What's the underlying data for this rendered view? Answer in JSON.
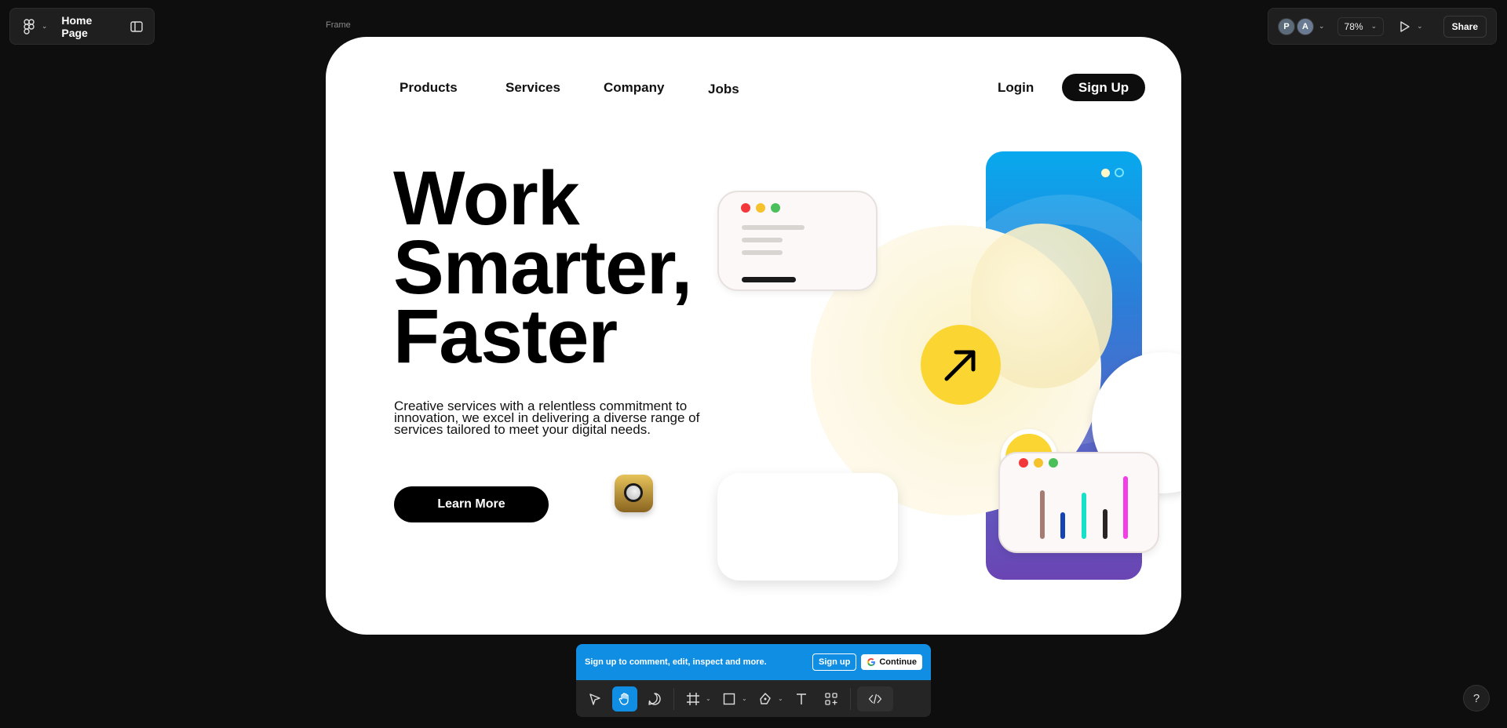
{
  "file": {
    "title": "Home Page"
  },
  "frame_label": "Frame",
  "topbar": {
    "avatars": [
      "P",
      "A"
    ],
    "zoom": "78%",
    "share_label": "Share"
  },
  "site": {
    "nav": [
      "Products",
      "Services",
      "Company",
      "Jobs"
    ],
    "login": "Login",
    "signup": "Sign Up",
    "hero_title_lines": [
      "Work",
      "Smarter,",
      "Faster"
    ],
    "hero_subtitle": "Creative services with a relentless commitment to innovation, we excel in delivering a diverse range of services tailored to meet your digital needs.",
    "cta": "Learn More",
    "chart_bar_colors": [
      "#a67b74",
      "#1443b4",
      "#17e0c9",
      "#2b2424",
      "#f53ce8"
    ]
  },
  "banner": {
    "text": "Sign up to comment, edit, inspect and more.",
    "signup": "Sign up",
    "continue": "Continue"
  },
  "toolbar": {
    "tools": [
      "move-icon",
      "hand-icon",
      "comment-icon",
      "frame-icon",
      "rectangle-icon",
      "pen-icon",
      "text-icon",
      "components-icon",
      "code-icon"
    ],
    "active": "hand-icon"
  },
  "help": "?"
}
